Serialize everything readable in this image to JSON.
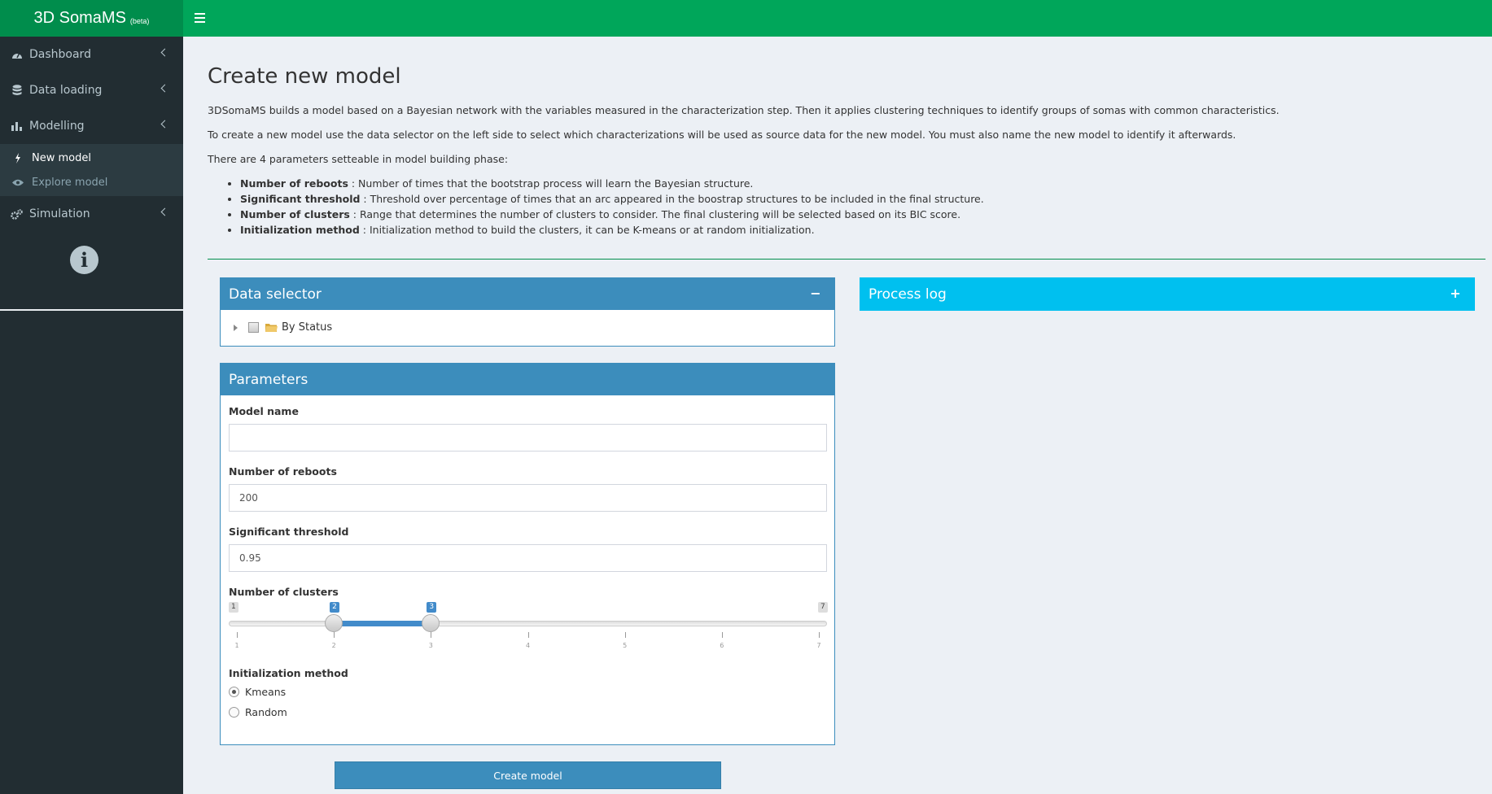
{
  "app": {
    "title": "3D SomaMS",
    "subtitle": "(beta)"
  },
  "sidebar": {
    "items": [
      {
        "label": "Dashboard",
        "icon": "dashboard-icon"
      },
      {
        "label": "Data loading",
        "icon": "database-icon"
      },
      {
        "label": "Modelling",
        "icon": "bar-chart-icon"
      },
      {
        "label": "Simulation",
        "icon": "gears-icon"
      }
    ],
    "submenu": [
      {
        "label": "New model",
        "icon": "bolt-icon",
        "active": true
      },
      {
        "label": "Explore model",
        "icon": "eye-icon",
        "active": false
      }
    ]
  },
  "page": {
    "title": "Create new model",
    "intro1": "3DSomaMS builds a model based on a Bayesian network with the variables measured in the characterization step. Then it applies clustering techniques to identify groups of somas with common characteristics.",
    "intro2": "To create a new model use the data selector on the left side to select which characterizations will be used as source data for the new model. You must also name the new model to identify it afterwards.",
    "intro3": "There are 4 parameters setteable in model building phase:",
    "params": [
      {
        "name": "Number of reboots",
        "desc": " : Number of times that the bootstrap process will learn the Bayesian structure."
      },
      {
        "name": "Significant threshold",
        "desc": " : Threshold over percentage of times that an arc appeared in the boostrap structures to be included in the final structure."
      },
      {
        "name": "Number of clusters",
        "desc": " : Range that determines the number of clusters to consider. The final clustering will be selected based on its BIC score."
      },
      {
        "name": "Initialization method",
        "desc": " : Initialization method to build the clusters, it can be K-means or at random initialization."
      }
    ]
  },
  "data_selector": {
    "title": "Data selector",
    "collapse": "−",
    "tree_node": "By Status"
  },
  "process_log": {
    "title": "Process log",
    "expand": "+"
  },
  "parameters": {
    "title": "Parameters",
    "model_name": {
      "label": "Model name",
      "value": ""
    },
    "reboots": {
      "label": "Number of reboots",
      "value": "200"
    },
    "threshold": {
      "label": "Significant threshold",
      "value": "0.95"
    },
    "clusters": {
      "label": "Number of clusters",
      "min": 1,
      "max": 7,
      "from": 2,
      "to": 3,
      "min_label": "1",
      "max_label": "7",
      "from_label": "2",
      "to_label": "3",
      "ticks": [
        "1",
        "2",
        "3",
        "4",
        "5",
        "6",
        "7"
      ]
    },
    "init_method": {
      "label": "Initialization method",
      "options": [
        "Kmeans",
        "Random"
      ],
      "selected": "Kmeans"
    }
  },
  "create_button": "Create model",
  "colors": {
    "header": "#00a65a",
    "logo_bg": "#008d4c",
    "sidebar": "#222d32",
    "primary": "#3c8dbc",
    "info": "#00c0ef",
    "content_bg": "#ecf0f5"
  }
}
